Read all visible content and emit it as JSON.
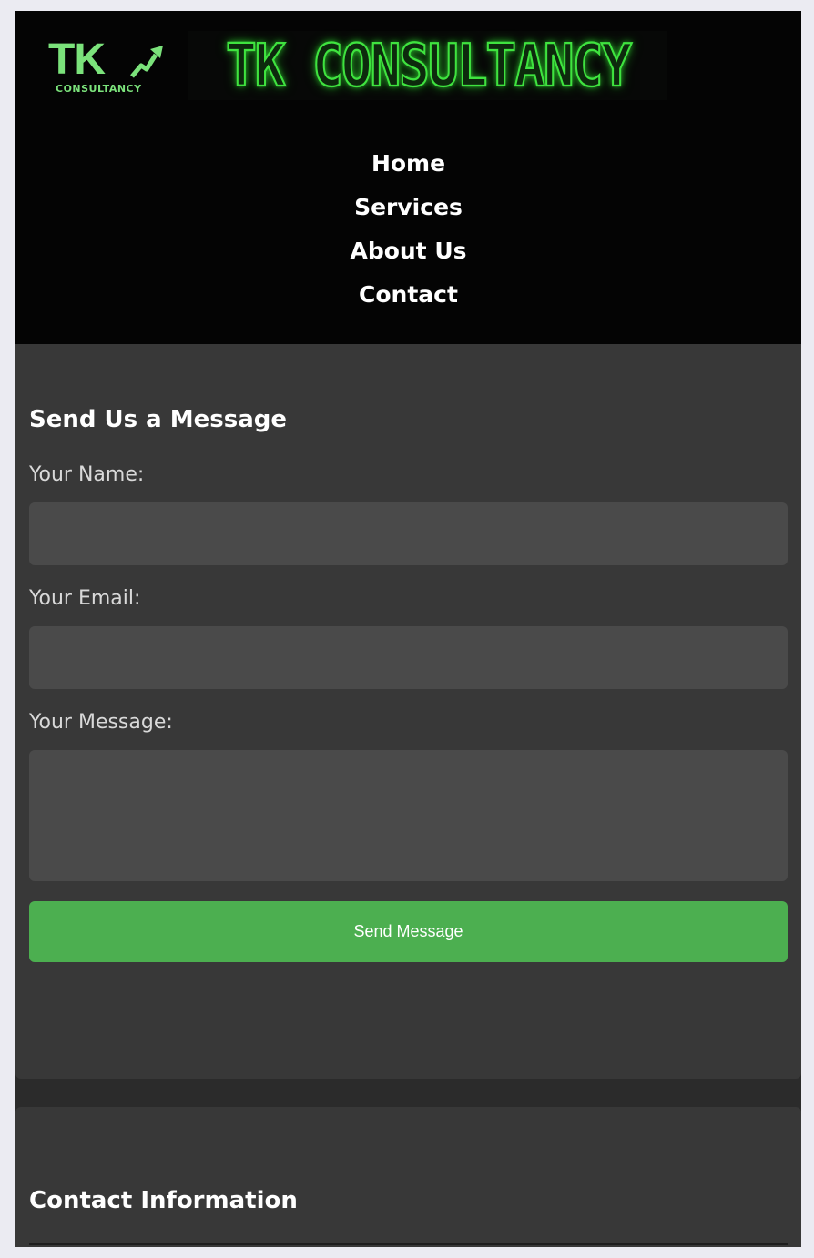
{
  "brand": {
    "logo_main": "TK",
    "logo_sub": "CONSULTANCY",
    "banner_text": "TK CONSULTANCY",
    "accent_color": "#7be27b"
  },
  "nav": {
    "items": [
      {
        "label": "Home"
      },
      {
        "label": "Services"
      },
      {
        "label": "About Us"
      },
      {
        "label": "Contact"
      }
    ]
  },
  "form": {
    "title": "Send Us a Message",
    "name_label": "Your Name:",
    "name_value": "",
    "email_label": "Your Email:",
    "email_value": "",
    "message_label": "Your Message:",
    "message_value": "",
    "submit_label": "Send Message",
    "submit_color": "#4caf50"
  },
  "contact_info": {
    "title": "Contact Information"
  }
}
